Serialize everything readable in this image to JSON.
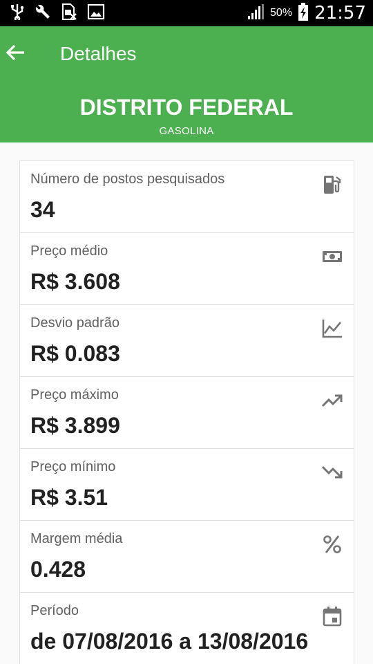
{
  "status_bar": {
    "battery": "50%",
    "time": "21:57",
    "icons": [
      "usb-icon",
      "wrench-icon",
      "sim-icon",
      "image-icon",
      "signal-icon",
      "battery-charging-icon"
    ]
  },
  "app_bar": {
    "title": "Detalhes",
    "back_icon": "arrow-back-icon",
    "background": "#4caf50"
  },
  "header": {
    "region": "DISTRITO FEDERAL",
    "fuel": "GASOLINA"
  },
  "details": [
    {
      "label": "Número de postos pesquisados",
      "value": "34",
      "icon": "gas-station-icon"
    },
    {
      "label": "Preço médio",
      "value": "R$ 3.608",
      "icon": "money-icon"
    },
    {
      "label": "Desvio padrão",
      "value": "R$ 0.083",
      "icon": "chart-line-icon"
    },
    {
      "label": "Preço máximo",
      "value": "R$ 3.899",
      "icon": "trending-up-icon"
    },
    {
      "label": "Preço mínimo",
      "value": "R$ 3.51",
      "icon": "trending-down-icon"
    },
    {
      "label": "Margem média",
      "value": "0.428",
      "icon": "percent-icon"
    },
    {
      "label": "Período",
      "value": "de 07/08/2016 a 13/08/2016",
      "icon": "calendar-icon"
    }
  ]
}
